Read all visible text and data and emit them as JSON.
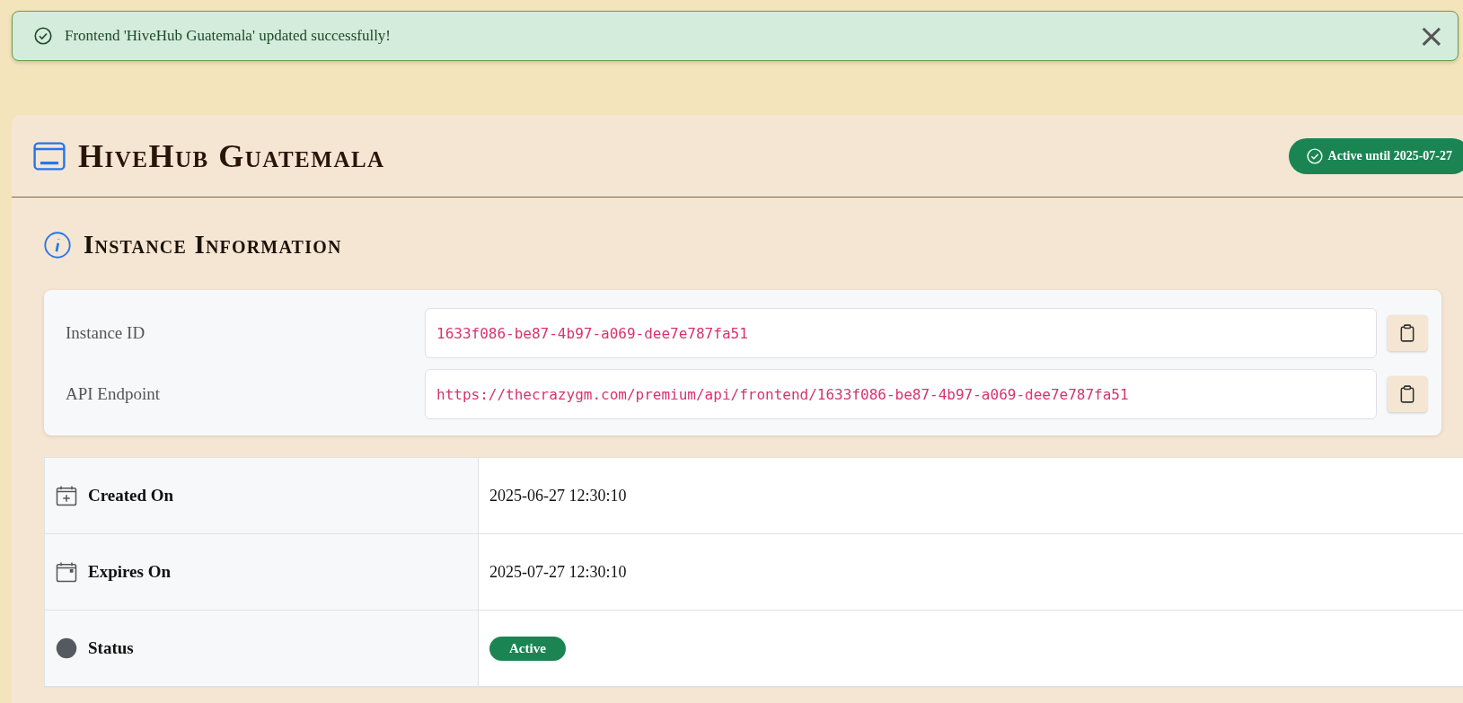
{
  "toast": {
    "message": "Frontend 'HiveHub Guatemala' updated successfully!",
    "close": "×"
  },
  "header": {
    "title": "HiveHub Guatemala",
    "badge": "Active until 2025-07-27"
  },
  "section": {
    "title": "Instance Information"
  },
  "fields": [
    {
      "label": "Instance ID",
      "value": "1633f086-be87-4b97-a069-dee7e787fa51"
    },
    {
      "label": "API Endpoint",
      "value": "https://thecrazygm.com/premium/api/frontend/1633f086-be87-4b97-a069-dee7e787fa51"
    }
  ],
  "table": {
    "rows": [
      {
        "kind": "created",
        "label": "Created On",
        "value": "2025-06-27 12:30:10"
      },
      {
        "kind": "expires",
        "label": "Expires On",
        "value": "2025-07-27 12:30:10"
      },
      {
        "kind": "status",
        "label": "Status",
        "value": "Active"
      }
    ]
  }
}
